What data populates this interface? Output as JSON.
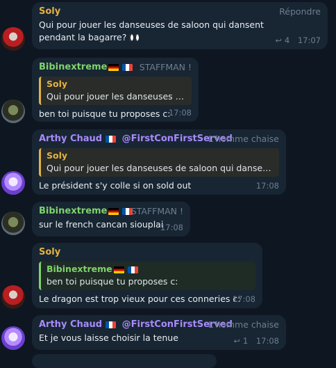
{
  "messages": [
    {
      "author": "Soly",
      "action": "Répondre",
      "text": "Qui pour jouer les danseuses de saloon qui dansent pendant la bagarre?",
      "reply_count": "4",
      "time": "17:07"
    },
    {
      "author": "Bibinextreme",
      "tag": "STAFFMAN !",
      "quote_author": "Soly",
      "quote_text": "Qui pour jouer les danseuses de ...",
      "text": "ben toi puisque tu proposes c:",
      "time": "17:08"
    },
    {
      "author": "Arthy Chaud",
      "author_handle": "@FirstConFirstServed",
      "tag": "L'homme chaise",
      "quote_author": "Soly",
      "quote_text": "Qui pour jouer les danseuses de saloon qui dansent p...",
      "text": "Le président s'y colle si on sold out",
      "time": "17:08"
    },
    {
      "author": "Bibinextreme",
      "tag": "STAFFMAN !",
      "text": "sur le french cancan siouplai",
      "time": "17:08"
    },
    {
      "author": "Soly",
      "quote_author": "Bibinextreme",
      "quote_text": "ben toi puisque tu proposes c:",
      "text": "Le dragon est trop vieux pour ces conneries c:",
      "time": "17:08"
    },
    {
      "author": "Arthy Chaud",
      "author_handle": "@FirstConFirstServed",
      "tag": "L'homme chaise",
      "text": "Et je vous laisse choisir la tenue",
      "reply_count": "1",
      "time": "17:08"
    }
  ],
  "colors": {
    "background": "#0e1621",
    "bubble": "#182533",
    "soly": "#e3b341",
    "bibinextreme": "#7fd36b",
    "arthy": "#a88bfa"
  },
  "icons": [
    "reply-arrow-icon",
    "eyes-emoji",
    "germany-flag-icon",
    "france-flag-icon"
  ]
}
